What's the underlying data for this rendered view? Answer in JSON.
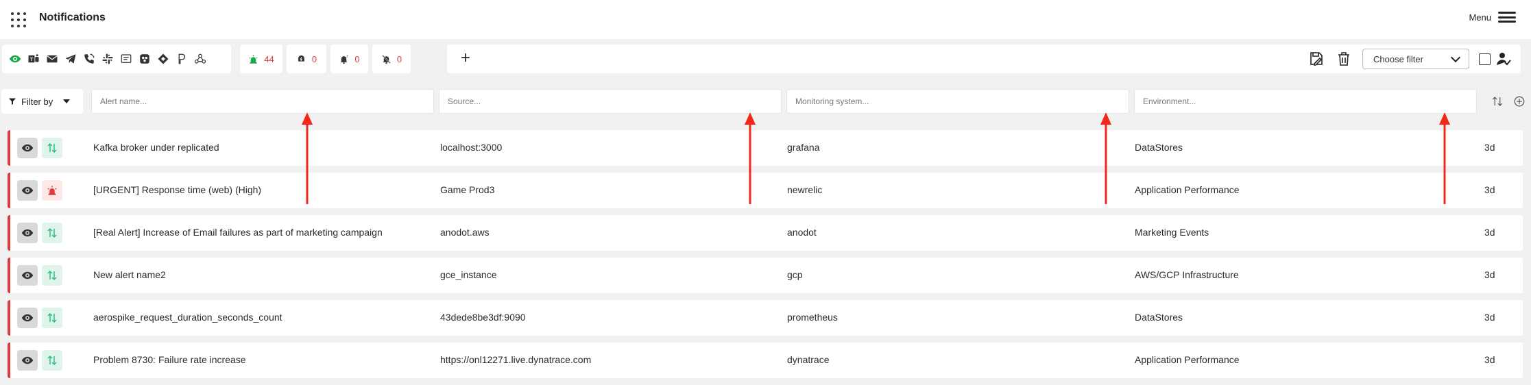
{
  "header": {
    "title": "Notifications",
    "menu_label": "Menu"
  },
  "channels": [
    "eye-icon",
    "teams-icon",
    "email-icon",
    "telegram-icon",
    "phone-icon",
    "slack-icon",
    "sms-icon",
    "webex-icon",
    "jira-icon",
    "pagerduty-icon",
    "webhook-icon"
  ],
  "counters": [
    {
      "name": "firing-alerts",
      "count": "44",
      "icon": "siren-icon"
    },
    {
      "name": "acknowledged-alerts",
      "count": "0",
      "icon": "ack-icon"
    },
    {
      "name": "snoozed-alerts",
      "count": "0",
      "icon": "bell-snooze-icon"
    },
    {
      "name": "muted-alerts",
      "count": "0",
      "icon": "bell-off-icon"
    }
  ],
  "toolbar": {
    "add_label": "+",
    "choose_filter": "Choose filter"
  },
  "filters": {
    "filter_by": "Filter by",
    "alert_name_placeholder": "Alert name...",
    "source_placeholder": "Source...",
    "monitoring_placeholder": "Monitoring system...",
    "environment_placeholder": "Environment..."
  },
  "alerts": [
    {
      "name": "Kafka broker under replicated",
      "source": "localhost:3000",
      "monitoring": "grafana",
      "environment": "DataStores",
      "age": "3d",
      "status": "arrows"
    },
    {
      "name": "[URGENT] Response time (web) (High)",
      "source": "Game Prod3",
      "monitoring": "newrelic",
      "environment": "Application Performance",
      "age": "3d",
      "status": "siren"
    },
    {
      "name": "[Real Alert] Increase of Email failures as part of marketing campaign",
      "source": "anodot.aws",
      "monitoring": "anodot",
      "environment": "Marketing Events",
      "age": "3d",
      "status": "arrows"
    },
    {
      "name": "New alert name2",
      "source": "gce_instance",
      "monitoring": "gcp",
      "environment": "AWS/GCP Infrastructure",
      "age": "3d",
      "status": "arrows"
    },
    {
      "name": "aerospike_request_duration_seconds_count",
      "source": "43dede8be3df:9090",
      "monitoring": "prometheus",
      "environment": "DataStores",
      "age": "3d",
      "status": "arrows"
    },
    {
      "name": "Problem 8730: Failure rate increase",
      "source": "https://onl12271.live.dynatrace.com",
      "monitoring": "dynatrace",
      "environment": "Application Performance",
      "age": "3d",
      "status": "arrows"
    }
  ],
  "colors": {
    "accent_red": "#e03b3b",
    "eye_green": "#1aa84a",
    "status_green": "#2fbf85",
    "annotation_arrow": "#f1281a"
  }
}
